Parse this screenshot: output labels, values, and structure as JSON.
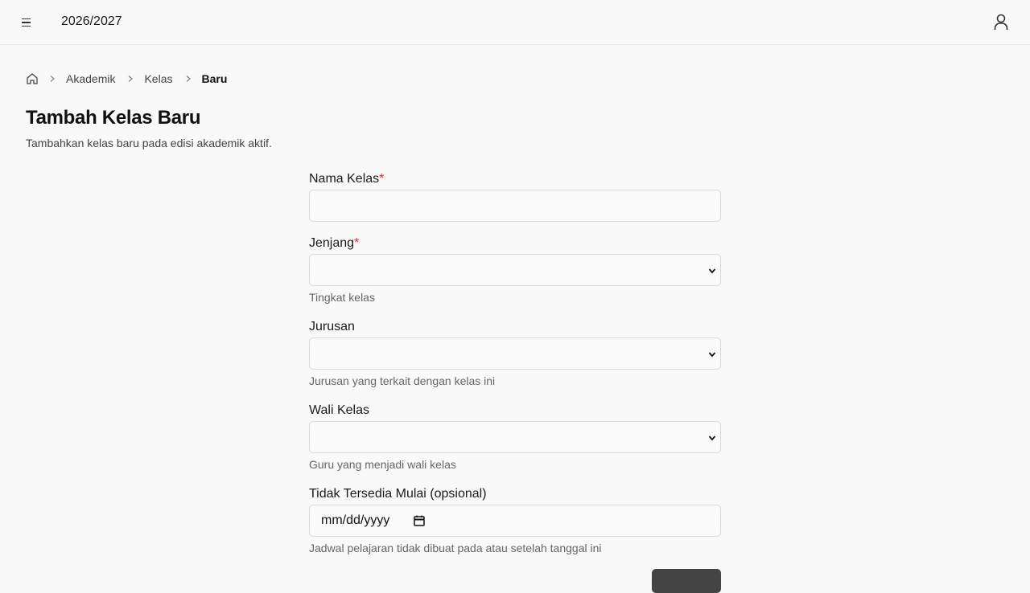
{
  "header": {
    "year": "2026/2027",
    "menu_icon": "hamburger-icon",
    "user_icon": "user-icon"
  },
  "breadcrumb": {
    "home_icon": "home-icon",
    "items": [
      "Akademik",
      "Kelas"
    ],
    "current": "Baru"
  },
  "page": {
    "title": "Tambah Kelas Baru",
    "subtitle": "Tambahkan kelas baru pada edisi akademik aktif."
  },
  "form": {
    "nama_kelas": {
      "label": "Nama Kelas",
      "required": "*",
      "value": ""
    },
    "jenjang": {
      "label": "Jenjang",
      "required": "*",
      "value": "",
      "hint": "Tingkat kelas"
    },
    "jurusan": {
      "label": "Jurusan",
      "value": "",
      "hint": "Jurusan yang terkait dengan kelas ini"
    },
    "wali_kelas": {
      "label": "Wali Kelas",
      "value": "",
      "hint": "Guru yang menjadi wali kelas"
    },
    "tidak_tersedia": {
      "label": "Tidak Tersedia Mulai (opsional)",
      "placeholder": "mm/dd/yyyy",
      "hint": "Jadwal pelajaran tidak dibuat pada atau setelah tanggal ini"
    }
  },
  "colors": {
    "background": "#f9f9f9",
    "required": "#d93025",
    "button": "#444444"
  }
}
